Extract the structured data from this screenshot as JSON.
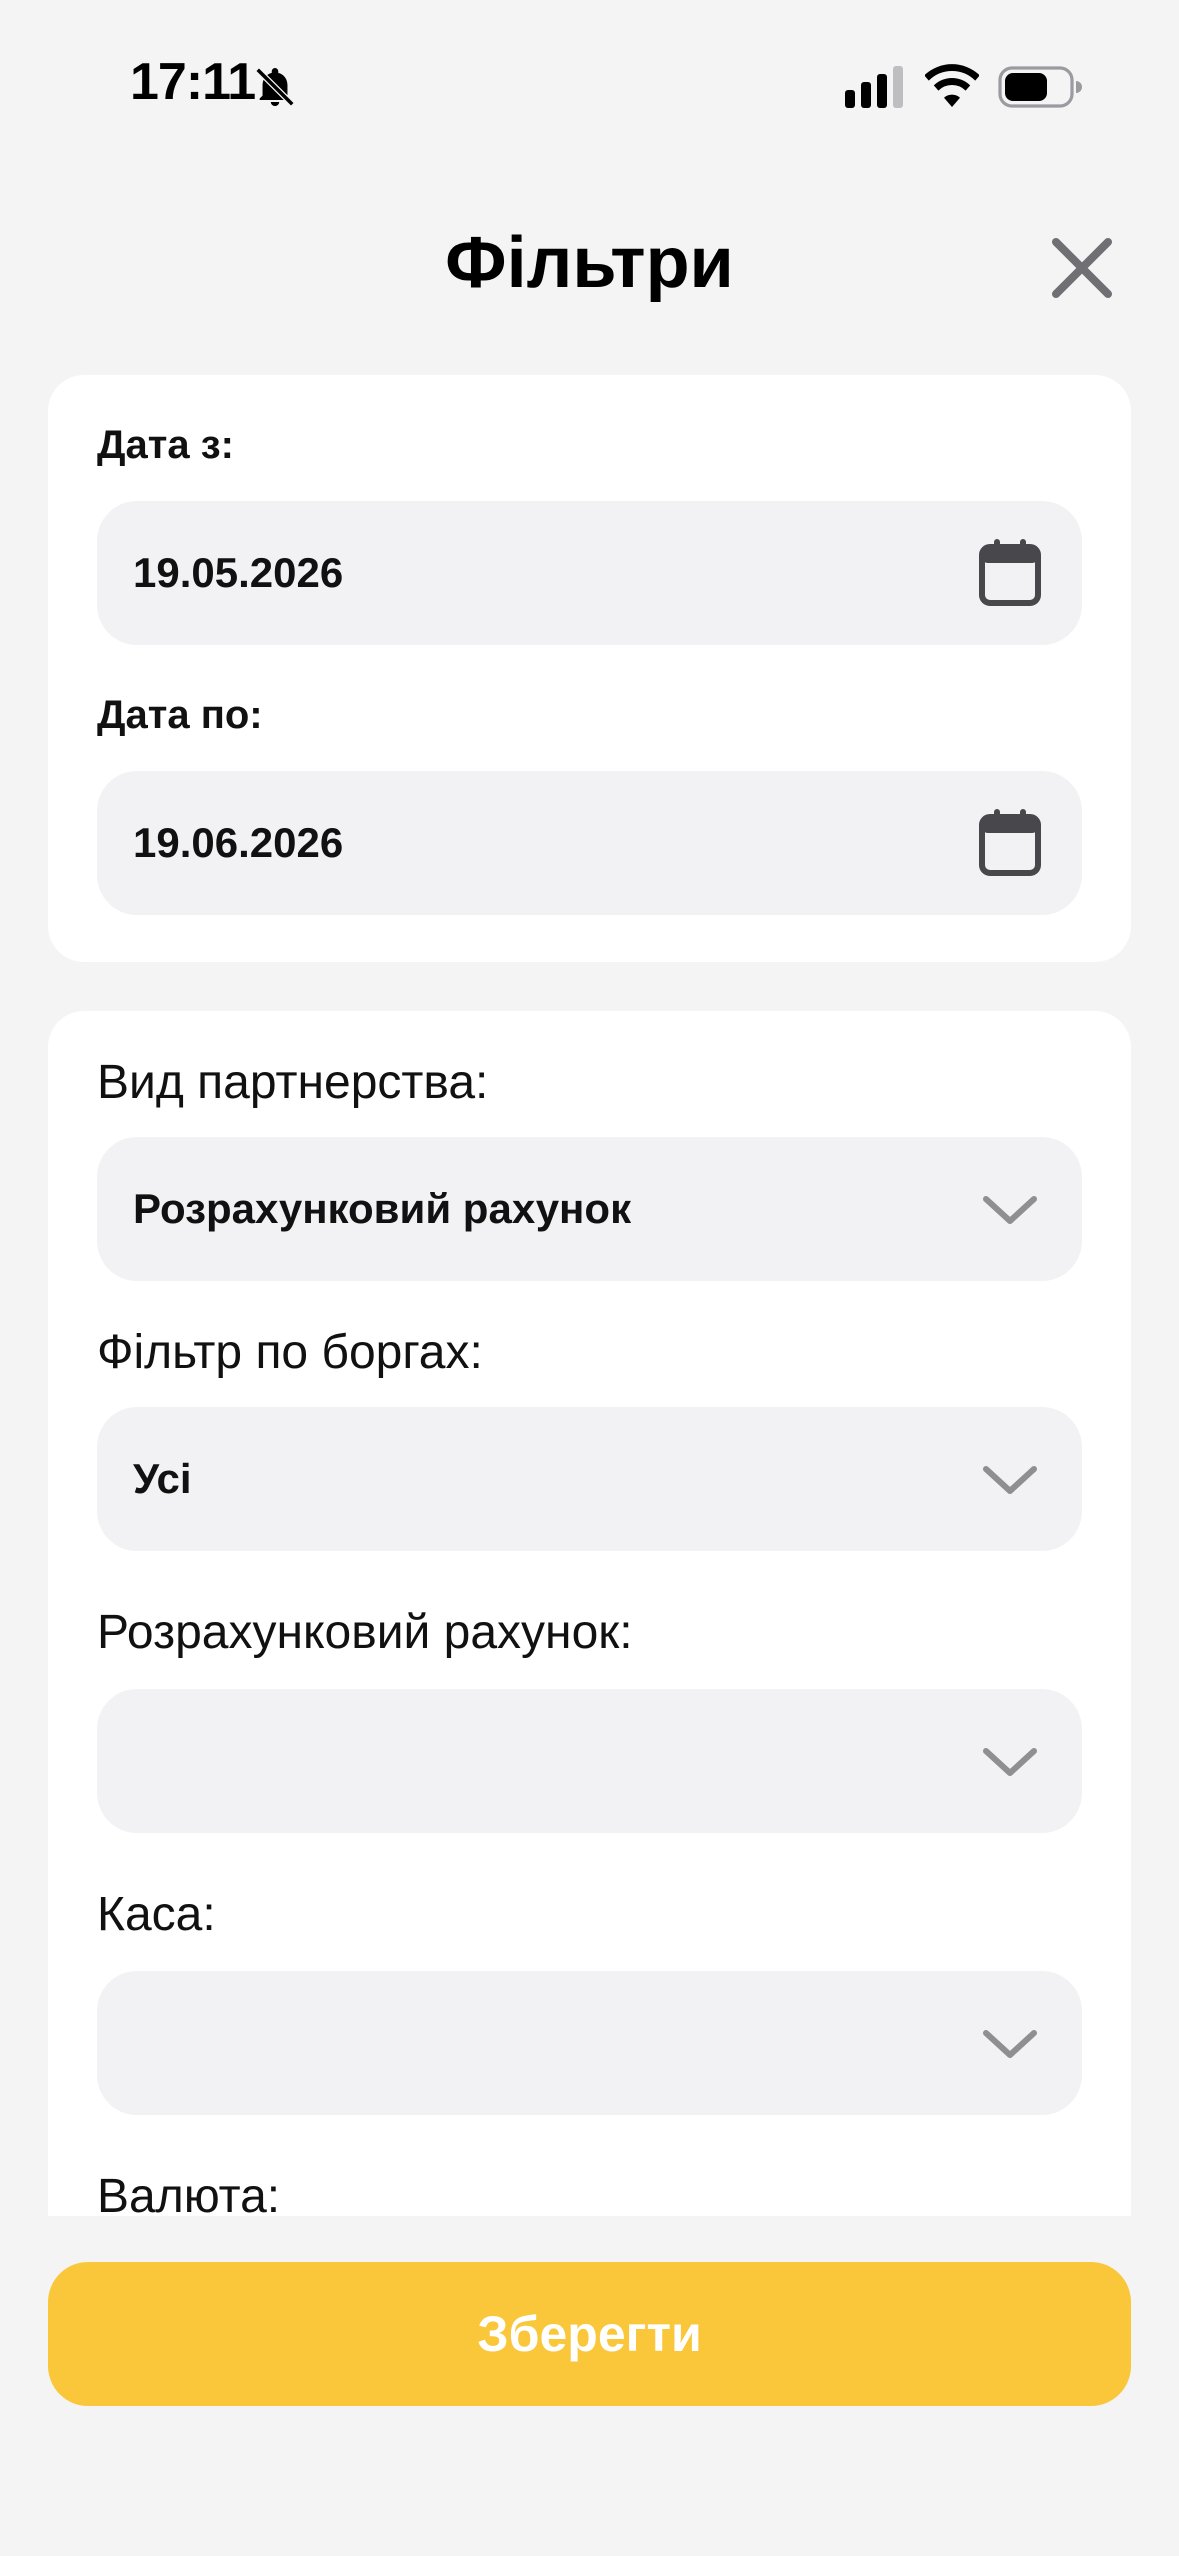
{
  "status_bar": {
    "time": "17:11"
  },
  "header": {
    "title": "Фільтри",
    "close_icon": "close-icon"
  },
  "dates": {
    "from_label": "Дата з:",
    "from_value": "19.05.2026",
    "to_label": "Дата по:",
    "to_value": "19.06.2026"
  },
  "filters": {
    "partnership_label": "Вид партнерства:",
    "partnership_value": "Розрахунковий рахунок",
    "debts_label": "Фільтр по боргах:",
    "debts_value": "Усі",
    "account_label": "Розрахунковий рахунок:",
    "account_value": "",
    "cashbox_label": "Каса:",
    "cashbox_value": "",
    "currency_label": "Валюта:"
  },
  "actions": {
    "save_label": "Зберегти"
  },
  "colors": {
    "background": "#F4F4F5",
    "card": "#FFFFFF",
    "field": "#F2F2F4",
    "accent": "#FAC73A",
    "icon": "#48484C"
  }
}
